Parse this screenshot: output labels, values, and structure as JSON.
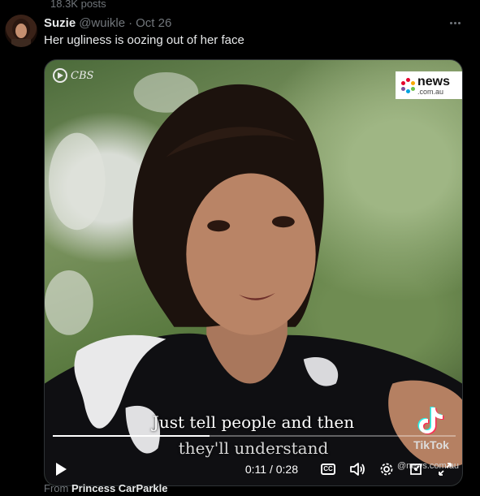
{
  "top": {
    "posts_count": "18.3K posts"
  },
  "tweet": {
    "display_name": "Suzie",
    "handle": "@wuikle",
    "separator": "·",
    "time": "Oct 26",
    "text": "Her ugliness is oozing out of her face"
  },
  "media": {
    "cbs_label": "CBS",
    "news_logo": {
      "word": "news",
      "domain": ".com.au"
    },
    "caption_line1": "Just tell people and then",
    "caption_line2": "they'll understand",
    "tiktok_label": "TikTok",
    "tiktok_handle": "@news.com.au",
    "player": {
      "timecode": "0:11 / 0:28",
      "progress": 0.39,
      "cc_label": "CC"
    }
  },
  "source": {
    "prefix": "From",
    "name": "Princess CarParkle"
  },
  "colors": {
    "background": "#000000",
    "text_primary": "#e7e9ea",
    "text_secondary": "#71767b",
    "border": "#2f3336"
  },
  "icons": [
    "more-icon",
    "cbs-eye-icon",
    "news-dots-icon",
    "tiktok-icon",
    "play-icon",
    "cc-icon",
    "volume-icon",
    "settings-icon",
    "minimize-icon",
    "fullscreen-icon"
  ]
}
